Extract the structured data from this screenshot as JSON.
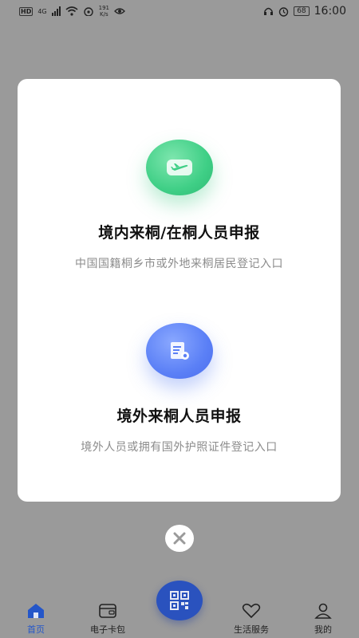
{
  "status_bar": {
    "network_badge": "HD",
    "network_type": "4G",
    "speed_value": "191",
    "speed_unit": "K/s",
    "battery": "68",
    "time": "16:00",
    "icons": [
      "signal-icon",
      "wifi-icon",
      "hotspot-icon",
      "eye-icon",
      "headset-icon",
      "alarm-icon",
      "battery-icon"
    ]
  },
  "dialog": {
    "entries": [
      {
        "icon": "airplane-icon",
        "icon_color": "#3fcf86",
        "title": "境内来桐/在桐人员申报",
        "subtitle": "中国国籍桐乡市或外地来桐居民登记入口"
      },
      {
        "icon": "document-icon",
        "icon_color": "#5b80f6",
        "title": "境外来桐人员申报",
        "subtitle": "境外人员或拥有国外护照证件登记入口"
      }
    ],
    "close_icon": "close-icon"
  },
  "tabbar": {
    "accent": "#2456c9",
    "items": [
      {
        "label": "首页",
        "icon": "home-icon",
        "active": true
      },
      {
        "label": "电子卡包",
        "icon": "card-wallet-icon",
        "active": false
      },
      {
        "label": "",
        "icon": "qr-code-icon",
        "active": false
      },
      {
        "label": "生活服务",
        "icon": "heart-icon",
        "active": false
      },
      {
        "label": "我的",
        "icon": "person-icon",
        "active": false
      }
    ]
  }
}
